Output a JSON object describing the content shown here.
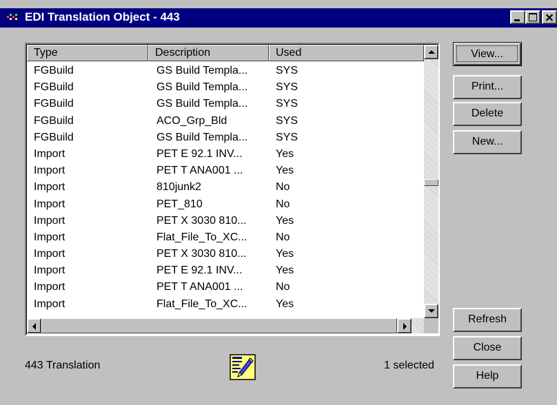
{
  "window": {
    "title": "EDI Translation Object - 443",
    "app_icon": "edi-app-icon",
    "controls": [
      "minimize-icon",
      "maximize-icon",
      "close-icon"
    ]
  },
  "list": {
    "columns": [
      "Type",
      "Description",
      "Used"
    ],
    "rows": [
      {
        "type": "FGBuild",
        "description": "GS Build Templa...",
        "used": "SYS"
      },
      {
        "type": "FGBuild",
        "description": "GS Build Templa...",
        "used": "SYS"
      },
      {
        "type": "FGBuild",
        "description": "GS Build Templa...",
        "used": "SYS"
      },
      {
        "type": "FGBuild",
        "description": "ACO_Grp_Bld",
        "used": "SYS"
      },
      {
        "type": "FGBuild",
        "description": "GS Build Templa...",
        "used": "SYS"
      },
      {
        "type": "Import",
        "description": "PET E 92.1 INV...",
        "used": "Yes"
      },
      {
        "type": "Import",
        "description": "PET T ANA001 ...",
        "used": "Yes"
      },
      {
        "type": "Import",
        "description": "810junk2",
        "used": "No"
      },
      {
        "type": "Import",
        "description": "PET_810",
        "used": "No"
      },
      {
        "type": "Import",
        "description": "PET X 3030 810...",
        "used": "Yes"
      },
      {
        "type": "Import",
        "description": "Flat_File_To_XC...",
        "used": "No"
      },
      {
        "type": "Import",
        "description": "PET X 3030 810...",
        "used": "Yes"
      },
      {
        "type": "Import",
        "description": "PET E 92.1 INV...",
        "used": "Yes"
      },
      {
        "type": "Import",
        "description": "PET T ANA001 ...",
        "used": "No"
      },
      {
        "type": "Import",
        "description": "Flat_File_To_XC...",
        "used": "Yes"
      }
    ],
    "vertical_scroll_position": 0.53
  },
  "buttons": {
    "view": "View...",
    "print": "Print...",
    "delete": "Delete",
    "new": "New...",
    "refresh": "Refresh",
    "close": "Close",
    "help": "Help"
  },
  "status": {
    "count": "443 Translation",
    "selected": "1 selected",
    "icon": "notepad-pencil-icon"
  },
  "colors": {
    "titlebar": "#000080",
    "face": "#c0c0c0"
  }
}
